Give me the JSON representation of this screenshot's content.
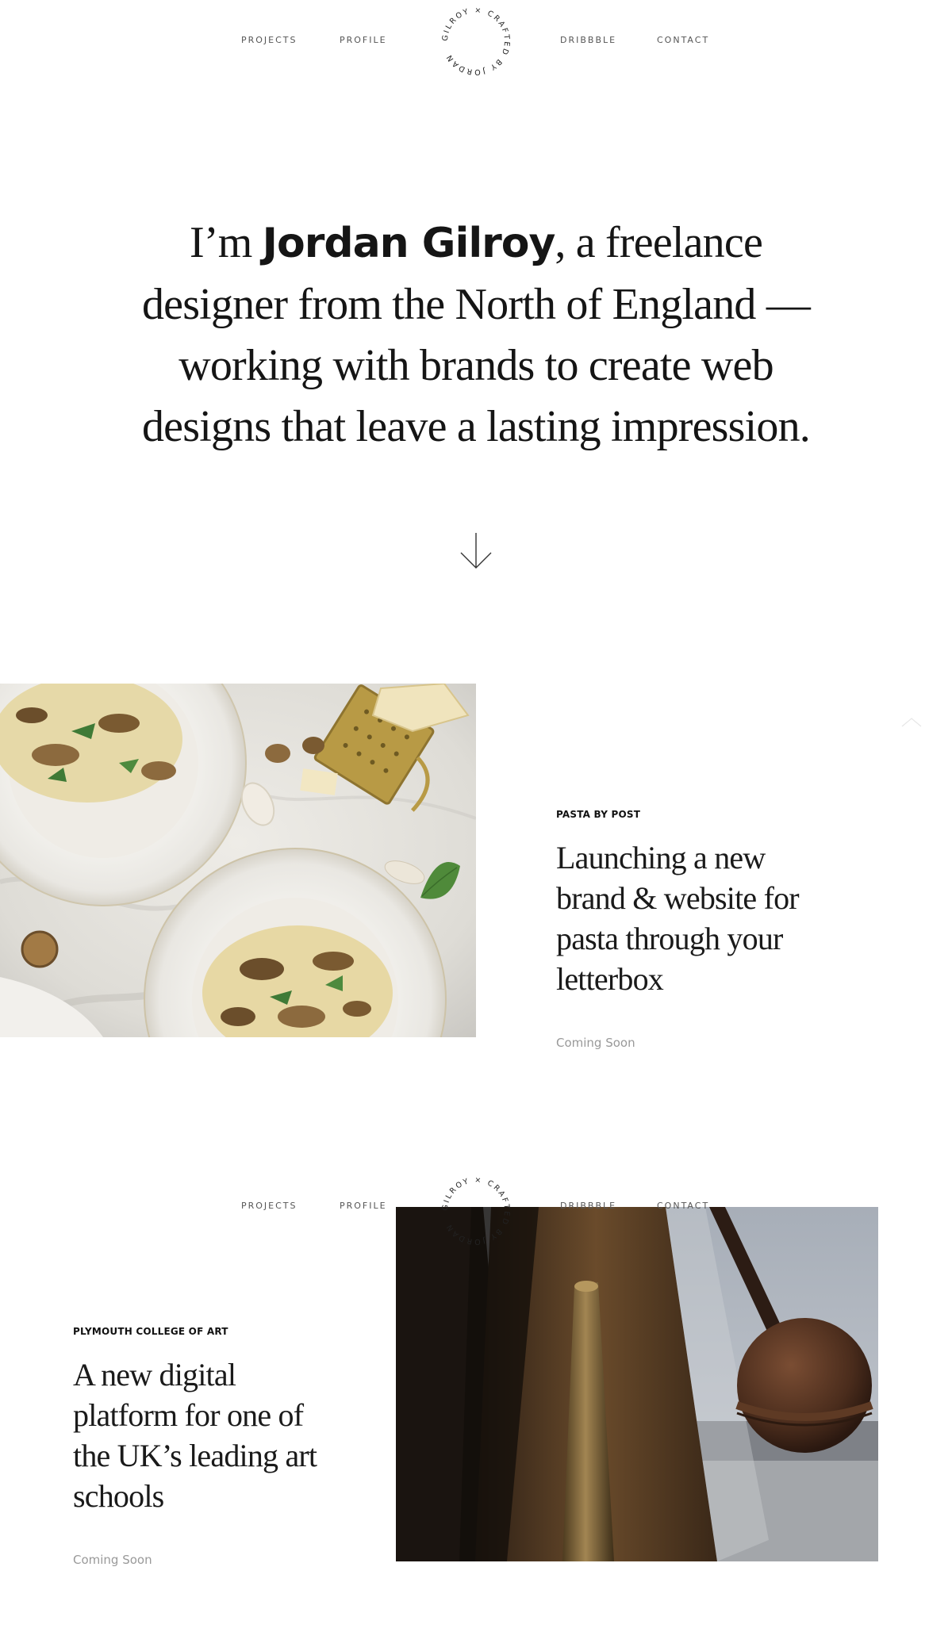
{
  "nav": {
    "links": [
      "Projects",
      "Profile",
      "Dribbble",
      "Contact"
    ],
    "logo_ring_text": "Gilroy × Crafted by Jordan "
  },
  "hero": {
    "intro": "I’m ",
    "name": "Jordan Gilroy",
    "line1_rest": ", a freelance",
    "line2": "designer from the North of England —",
    "line3": "working with brands to create web",
    "line4": "designs that leave a lasting impression."
  },
  "projects": [
    {
      "client": "Pasta by Post",
      "title_lines": [
        "Launching a new",
        "brand & website for",
        "pasta through your",
        "letterbox"
      ],
      "status": "Coming Soon",
      "image_icon": "pasta-photo"
    },
    {
      "client": "Plymouth College of Art",
      "title_lines": [
        "A new digital",
        "platform for one of",
        "the UK’s leading art",
        "schools"
      ],
      "status": "Coming Soon",
      "image_icon": "sculpture-photo"
    }
  ],
  "colors": {
    "text": "#151515",
    "muted": "#999999",
    "nav": "#555555"
  }
}
